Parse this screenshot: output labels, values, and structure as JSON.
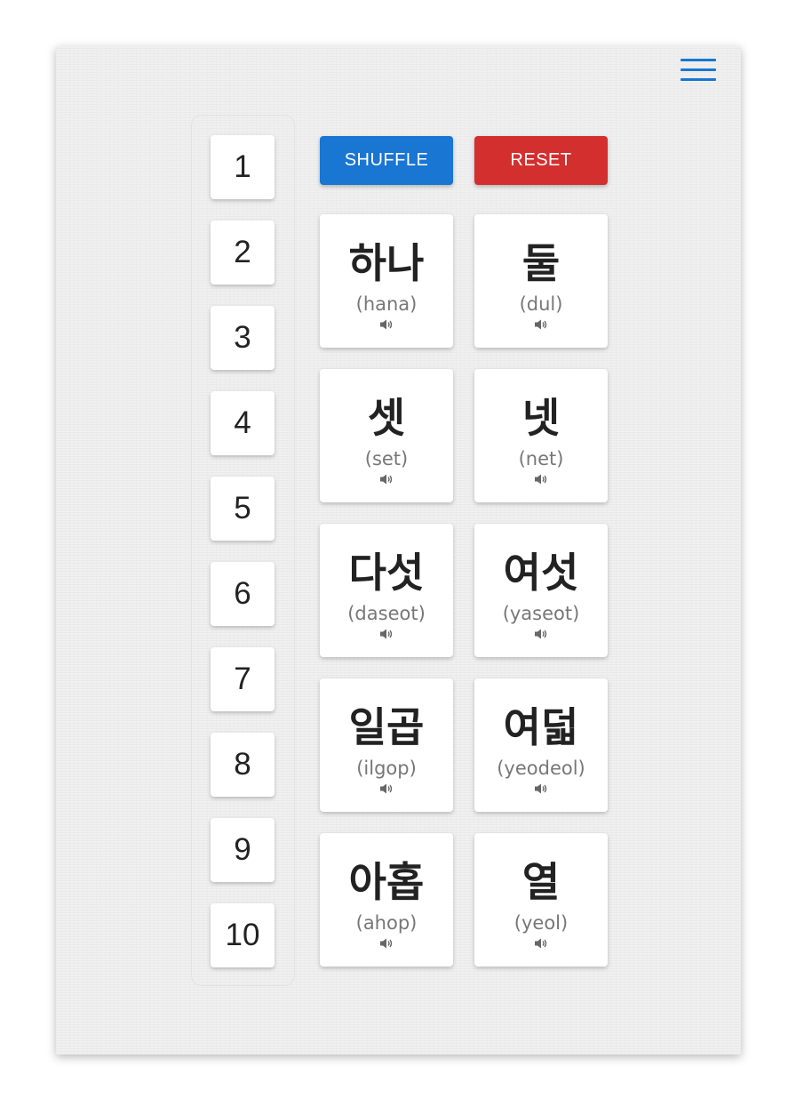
{
  "menu": {
    "icon": "hamburger-menu-icon",
    "color": "#1976d2"
  },
  "numbers": [
    "1",
    "2",
    "3",
    "4",
    "5",
    "6",
    "7",
    "8",
    "9",
    "10"
  ],
  "buttons": {
    "shuffle_label": "SHUFFLE",
    "reset_label": "RESET",
    "shuffle_color": "#1976d2",
    "reset_color": "#d32f2f"
  },
  "cards": [
    {
      "korean": "하나",
      "romanization": "(hana)"
    },
    {
      "korean": "둘",
      "romanization": "(dul)"
    },
    {
      "korean": "셋",
      "romanization": "(set)"
    },
    {
      "korean": "넷",
      "romanization": "(net)"
    },
    {
      "korean": "다섯",
      "romanization": "(daseot)"
    },
    {
      "korean": "여섯",
      "romanization": "(yaseot)"
    },
    {
      "korean": "일곱",
      "romanization": "(ilgop)"
    },
    {
      "korean": "여덟",
      "romanization": "(yeodeol)"
    },
    {
      "korean": "아홉",
      "romanization": "(ahop)"
    },
    {
      "korean": "열",
      "romanization": "(yeol)"
    }
  ],
  "card_icon": "speaker-icon"
}
